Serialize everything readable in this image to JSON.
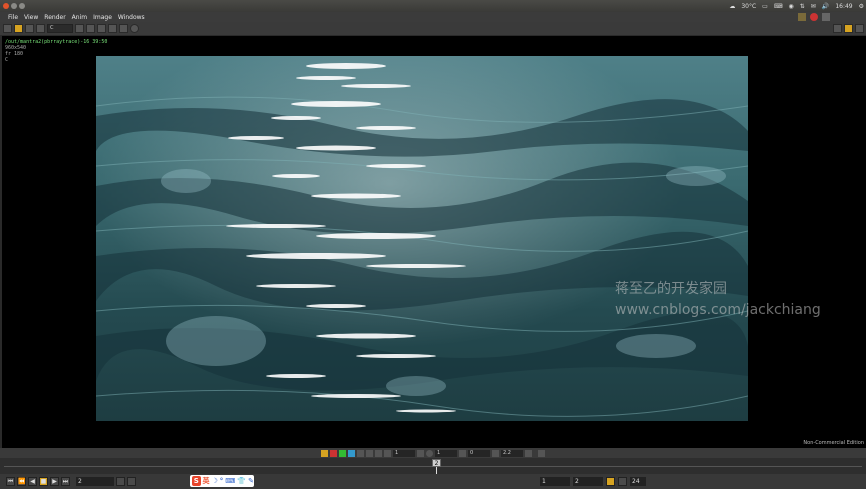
{
  "menu": {
    "items": [
      "File",
      "View",
      "Render",
      "Anim",
      "Image",
      "Windows"
    ]
  },
  "system": {
    "weather": "30°C",
    "clock": "16:49"
  },
  "toolbar": {
    "select_value": "C"
  },
  "viewport": {
    "render_path": "/out/mantra2(pbrraytrace)-16 39:50",
    "resolution": "960x540",
    "frame_info": "fr 180",
    "channel": "C",
    "edition": "Non-Commercial Edition",
    "watermark_line1": "蒋至乙的开发家园",
    "watermark_line2": "www.cnblogs.com/jackchiang"
  },
  "viewer_controls": {
    "field1": "1",
    "field2": "1",
    "field3": "0",
    "gamma": "2.2"
  },
  "timeline": {
    "current_frame": "2"
  },
  "playback": {
    "frame_field": "2",
    "range_start": "1",
    "range_end": "2",
    "fps": "24"
  },
  "ime": {
    "s_label": "S",
    "lang": "英"
  },
  "colors": {
    "accent": "#d6a321",
    "close": "#e2532b"
  }
}
